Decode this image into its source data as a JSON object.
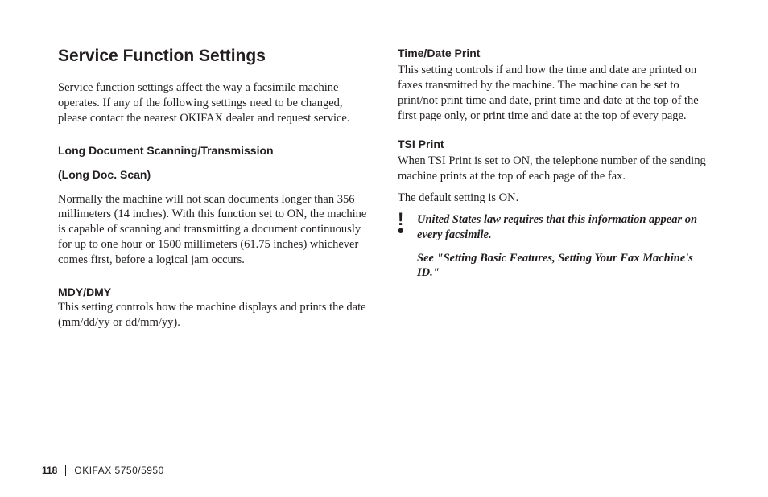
{
  "title": "Service Function Settings",
  "intro": "Service function settings affect the way a facsimile machine operates.  If any of the following settings need to be changed, please contact the nearest OKIFAX dealer and request service.",
  "longdoc": {
    "heading": "Long Document Scanning/Transmission",
    "subheading": "(Long Doc. Scan)",
    "body": "Normally the machine will not scan documents longer than 356 millimeters (14 inches).  With this function set to ON, the machine is capable of scanning and transmitting a document continuously for up to one hour or 1500 millimeters (61.75 inches) whichever comes first, before a logical jam occurs."
  },
  "mdy": {
    "heading": "MDY/DMY",
    "body": "This setting controls how the machine displays and prints the date (mm/dd/yy or dd/mm/yy)."
  },
  "timedate": {
    "heading": "Time/Date Print",
    "body": "This setting controls if and how the time and date are printed on faxes transmitted by the machine.  The machine can be set to print/not print time and date, print time and date at the top of the first page only, or print time and date at the top of every page."
  },
  "tsi": {
    "heading": "TSI Print",
    "body1": "When TSI Print is set to ON, the telephone number of the sending machine prints at the top of each page of the fax.",
    "body2": "The default setting is ON.",
    "note_mark_top": "!",
    "note_mark_bottom": "•",
    "note": "United States law requires that this information appear on every facsimile.",
    "see": "See \"Setting Basic Features, Setting Your Fax Machine's ID.\""
  },
  "footer": {
    "page": "118",
    "product": "OKIFAX 5750/5950"
  }
}
